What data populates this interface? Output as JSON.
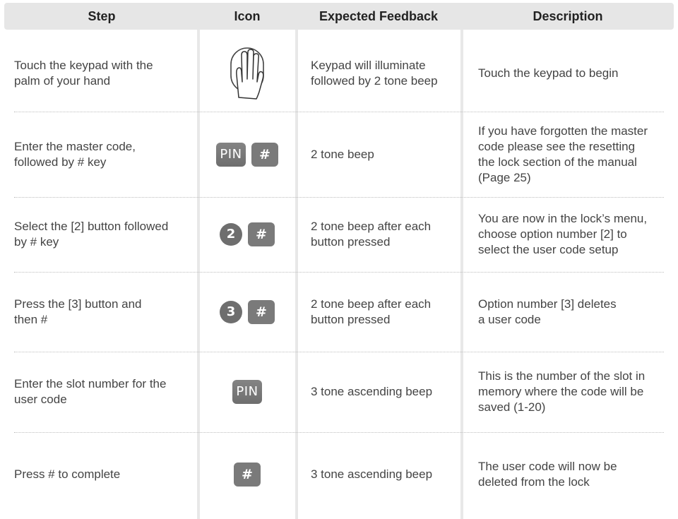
{
  "header": {
    "step": "Step",
    "icon": "Icon",
    "feedback": "Expected Feedback",
    "description": "Description"
  },
  "rows": [
    {
      "step": [
        "Touch the keypad with the",
        "palm of your hand"
      ],
      "icon": "palm-hand-icon",
      "feedback": [
        "Keypad will illuminate",
        "followed by 2 tone beep"
      ],
      "description": [
        "Touch the keypad to begin"
      ]
    },
    {
      "step": [
        "Enter the master code,",
        "followed by # key"
      ],
      "icon": "pin-and-hash-keys",
      "pin_label": "PIN",
      "hash_label": "#",
      "feedback": [
        "2 tone beep"
      ],
      "description": [
        "If you have forgotten the master",
        "code please see the resetting",
        "the lock section of the manual",
        "(Page 25)"
      ]
    },
    {
      "step": [
        "Select the [2] button followed",
        "by # key"
      ],
      "icon": "digit-2-and-hash-keys",
      "digit": "2",
      "hash_label": "#",
      "feedback": [
        "2 tone beep after each",
        "button pressed"
      ],
      "description": [
        "You are now in the lock’s menu,",
        "choose option number [2] to",
        "select the user code setup"
      ]
    },
    {
      "step": [
        "Press the [3] button and",
        "then #"
      ],
      "icon": "digit-3-and-hash-keys",
      "digit": "3",
      "hash_label": "#",
      "feedback": [
        "2 tone beep after each",
        "button pressed"
      ],
      "description": [
        "Option number [3] deletes",
        "a user code"
      ]
    },
    {
      "step": [
        "Enter the slot number for the",
        "user code"
      ],
      "icon": "pin-key",
      "pin_label": "PIN",
      "feedback": [
        "3 tone ascending beep"
      ],
      "description": [
        "This is the number of the slot in",
        "memory where the code will be",
        "saved (1-20)"
      ]
    },
    {
      "step": [
        "Press # to complete"
      ],
      "icon": "hash-key",
      "hash_label": "#",
      "feedback": [
        "3 tone ascending beep"
      ],
      "description": [
        "The user code will now be",
        "deleted from the lock"
      ]
    }
  ],
  "colors": {
    "header_bg": "#e6e6e6",
    "separator": "#e8e8e8",
    "key_bg": "#7a7a7a",
    "text": "#444444"
  }
}
